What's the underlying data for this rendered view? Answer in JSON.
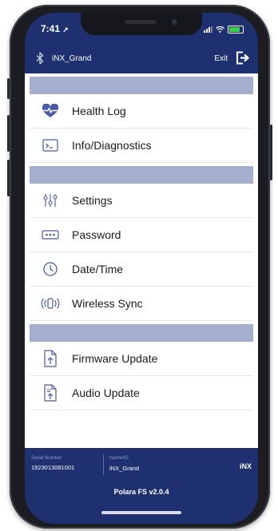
{
  "status_bar": {
    "time": "7:41"
  },
  "header": {
    "device_name": "iNX_Grand",
    "exit_label": "Exit"
  },
  "menu": {
    "groups": [
      {
        "items": [
          {
            "label": "Health Log",
            "icon": "heart-pulse-icon"
          },
          {
            "label": "Info/Diagnostics",
            "icon": "terminal-icon"
          }
        ]
      },
      {
        "items": [
          {
            "label": "Settings",
            "icon": "sliders-icon"
          },
          {
            "label": "Password",
            "icon": "password-dots-icon"
          },
          {
            "label": "Date/Time",
            "icon": "clock-icon"
          },
          {
            "label": "Wireless Sync",
            "icon": "wireless-sync-icon"
          }
        ]
      },
      {
        "items": [
          {
            "label": "Firmware Update",
            "icon": "firmware-file-icon"
          },
          {
            "label": "Audio Update",
            "icon": "audio-file-icon"
          }
        ]
      }
    ]
  },
  "footer": {
    "serial_label": "Serial Number",
    "serial_value": "1923013081001",
    "name_label": "Name/ID",
    "name_value": "iNX_Grand",
    "brand": "iNX",
    "version": "Polara FS v2.0.4"
  },
  "colors": {
    "primary": "#1e3070",
    "section_header": "#a6aecd",
    "icon": "#4a5a96",
    "heart": "#4a5aa6"
  }
}
